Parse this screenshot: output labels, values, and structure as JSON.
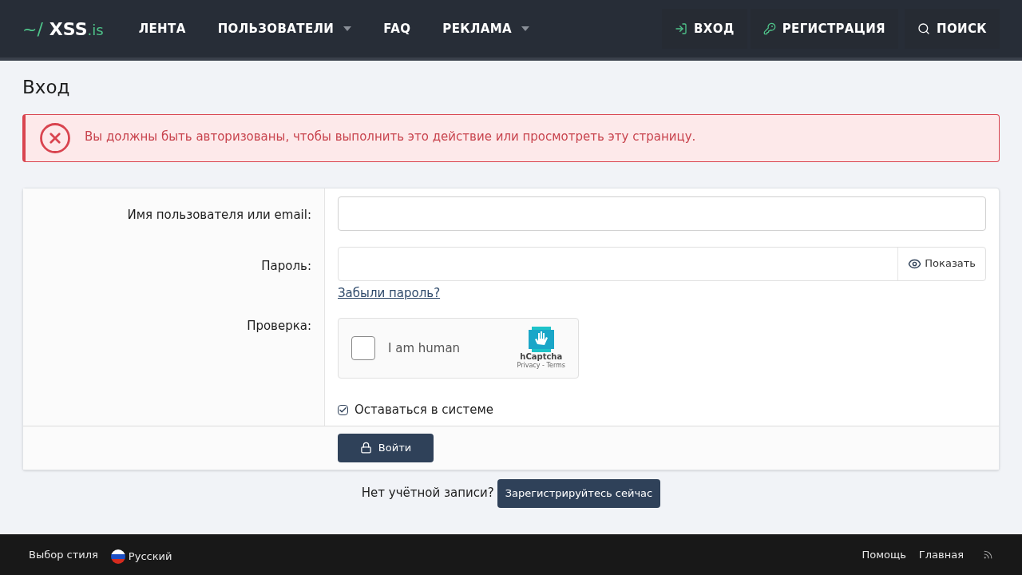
{
  "header": {
    "logo": {
      "prefix": "~/",
      "name": "XSS",
      "suffix": ".is"
    },
    "nav": [
      {
        "label": "ЛЕНТА",
        "dropdown": false
      },
      {
        "label": "ПОЛЬЗОВАТЕЛИ",
        "dropdown": true
      },
      {
        "label": "FAQ",
        "dropdown": false
      },
      {
        "label": "РЕКЛАМА",
        "dropdown": true
      }
    ],
    "actions": [
      {
        "kind": "login",
        "label": "ВХОД"
      },
      {
        "kind": "register",
        "label": "РЕГИСТРАЦИЯ"
      },
      {
        "kind": "search",
        "label": "ПОИСК"
      }
    ]
  },
  "page_title": "Вход",
  "alert": {
    "text": "Вы должны быть авторизованы, чтобы выполнить это действие или просмотреть эту страницу."
  },
  "form": {
    "username": {
      "label": "Имя пользователя или email:"
    },
    "password": {
      "label": "Пароль:",
      "show_button": "Показать",
      "forgot_link": "Забыли пароль?"
    },
    "captcha": {
      "label": "Проверка:",
      "checked": false,
      "text": "I am human",
      "brand": "hCaptcha",
      "links": "Privacy - Terms"
    },
    "remember": {
      "label": "Оставаться в системе",
      "checked": true
    },
    "submit": "Войти"
  },
  "register": {
    "prompt": "Нет учётной записи?",
    "button": "Зарегистрируйтесь сейчас"
  },
  "footer": {
    "style_chooser": "Выбор стиля",
    "language": "Русский",
    "links": [
      "Помощь",
      "Главная"
    ]
  }
}
